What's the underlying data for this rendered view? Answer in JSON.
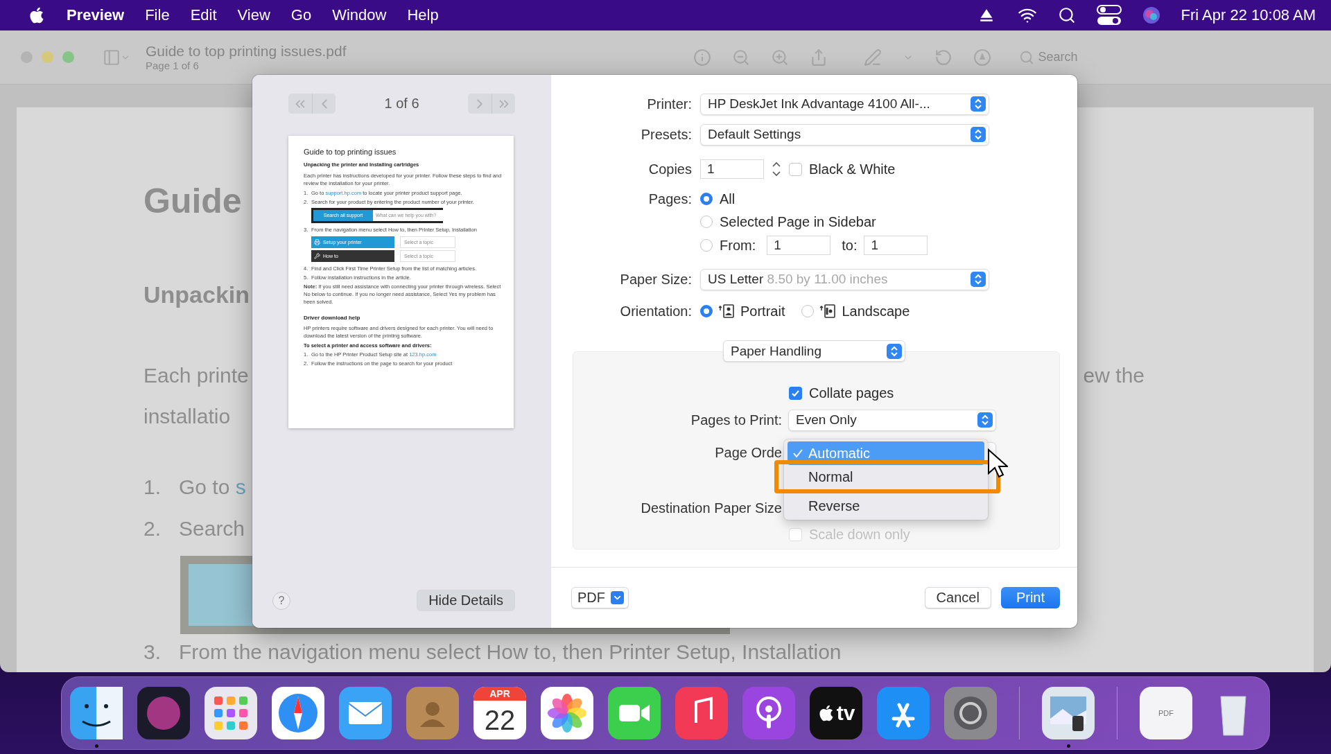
{
  "menu_bar": {
    "app": "Preview",
    "menus": [
      "File",
      "Edit",
      "View",
      "Go",
      "Window",
      "Help"
    ],
    "clock": "Fri Apr 22 10:08 AM"
  },
  "window": {
    "title": "Guide to top printing issues.pdf",
    "subtitle": "Page 1 of 6",
    "search_placeholder": "Search"
  },
  "document": {
    "lines": [
      {
        "kind": "title",
        "text": "Guide"
      },
      {
        "kind": "heading",
        "text": "Unpackin"
      },
      {
        "kind": "body",
        "text": "Each printe",
        "right": "ew the"
      },
      {
        "kind": "body",
        "text": "installatio"
      },
      {
        "kind": "list",
        "number": "1.",
        "text": "Go to ",
        "link": "s"
      },
      {
        "kind": "list",
        "number": "2.",
        "text": "Search"
      },
      {
        "kind": "image"
      },
      {
        "kind": "list",
        "number": "3.",
        "text": "From the navigation menu select How to, then Printer Setup, Installation"
      }
    ]
  },
  "print_dialog": {
    "sidebar": {
      "page_indicator": "1 of 6",
      "help": "?",
      "hide_details": "Hide Details"
    },
    "thumbnail": {
      "title": "Guide to top printing issues",
      "blocks": [
        {
          "kind": "heading",
          "text": "Unpacking the printer and Installing cartridges"
        },
        {
          "kind": "para",
          "text": "Each printer has instructions developed for your printer. Follow these steps to find and review the installation for your printer."
        },
        {
          "kind": "item",
          "number": "1.",
          "text": "Go to ",
          "link": "support.hp.com",
          "after": " to locate your printer product support page."
        },
        {
          "kind": "item",
          "number": "2.",
          "text": "Search for your product by entering the product number of your printer."
        },
        {
          "kind": "searchbar",
          "button": "Search all support",
          "placeholder": "What can we help you with?"
        },
        {
          "kind": "item",
          "number": "3.",
          "text": "From the navigation menu select How to, then Printer Setup, Installation"
        },
        {
          "kind": "menu",
          "rows": [
            {
              "label": "Setup your printer",
              "topic": "Select a topic",
              "color": "#1f9ad6"
            },
            {
              "label": "How to",
              "topic": "Select a topic",
              "color": "#333333"
            }
          ]
        },
        {
          "kind": "item",
          "number": "4.",
          "text": "Find and Click First Time Printer Setup from the list of matching articles."
        },
        {
          "kind": "item",
          "number": "5.",
          "text": "Follow installation instructions in the article."
        },
        {
          "kind": "para",
          "text": "**Note:** If you still need assistance with connecting your printer through wireless. Select No below to continue. If you no longer need assistance, Select Yes my problem has been solved."
        },
        {
          "kind": "subheading",
          "text": "Driver download help"
        },
        {
          "kind": "para",
          "text": "HP printers require software and drivers designed for each printer. You will need to download the latest version of the printing software."
        },
        {
          "kind": "bold",
          "text": "To select a printer and access software and drivers:"
        },
        {
          "kind": "item",
          "number": "1.",
          "text": "Go to the HP Printer Product Setup site at ",
          "link": "123.hp.com"
        },
        {
          "kind": "item",
          "number": "2.",
          "text": "Follow the instructions on the page to search for your product"
        }
      ]
    },
    "printer": {
      "label": "Printer:",
      "value": "HP DeskJet Ink Advantage 4100 All-..."
    },
    "presets": {
      "label": "Presets:",
      "value": "Default Settings"
    },
    "copies": {
      "label": "Copies",
      "value": "1",
      "black_white": {
        "label": "Black & White",
        "checked": false
      }
    },
    "pages": {
      "label": "Pages:",
      "options": [
        {
          "label": "All",
          "selected": true
        },
        {
          "label": "Selected Page in Sidebar",
          "selected": false
        },
        {
          "label": "From:",
          "selected": false
        }
      ],
      "from": "1",
      "to_label": "to:",
      "to": "1"
    },
    "paper_size": {
      "label": "Paper Size:",
      "value": "US Letter",
      "detail": "8.50 by 11.00 inches"
    },
    "orientation": {
      "label": "Orientation:",
      "options": [
        {
          "label": "Portrait",
          "kind": "portrait",
          "selected": true
        },
        {
          "label": "Landscape",
          "kind": "landscape",
          "selected": false
        }
      ]
    },
    "section": {
      "value": "Paper Handling"
    },
    "collate": {
      "label": "Collate pages",
      "checked": true
    },
    "pages_to_print": {
      "label": "Pages to Print:",
      "value": "Even Only"
    },
    "page_order": {
      "label": "Page Orde",
      "menu": [
        {
          "label": "Automatic",
          "selected": true,
          "highlighted": false
        },
        {
          "label": "Normal",
          "selected": false,
          "highlighted": true
        },
        {
          "label": "Reverse",
          "selected": false,
          "highlighted": false
        }
      ]
    },
    "destination_paper_size": {
      "label": "Destination Paper Size"
    },
    "scale_down": {
      "label": "Scale down only",
      "checked": false,
      "disabled": true
    },
    "pdf": "PDF",
    "cancel": "Cancel",
    "print": "Print"
  },
  "dock": {
    "items": [
      {
        "kind": "finder",
        "running": true
      },
      {
        "kind": "siri",
        "running": false
      },
      {
        "kind": "launchpad",
        "running": false
      },
      {
        "kind": "safari",
        "running": false
      },
      {
        "kind": "mail",
        "running": false
      },
      {
        "kind": "contacts",
        "running": false
      },
      {
        "kind": "calendar",
        "month": "APR",
        "day": "22",
        "running": false
      },
      {
        "kind": "photos",
        "running": false
      },
      {
        "kind": "facetime",
        "running": false
      },
      {
        "kind": "music",
        "running": false
      },
      {
        "kind": "podcasts",
        "running": false
      },
      {
        "kind": "tv",
        "label": "tv",
        "running": false
      },
      {
        "kind": "appstore",
        "running": false
      },
      {
        "kind": "settings",
        "running": false
      },
      {
        "kind": "divider"
      },
      {
        "kind": "preview",
        "running": true
      },
      {
        "kind": "divider"
      },
      {
        "kind": "pdf",
        "label": "PDF",
        "running": false
      },
      {
        "kind": "trash",
        "running": false
      }
    ]
  }
}
